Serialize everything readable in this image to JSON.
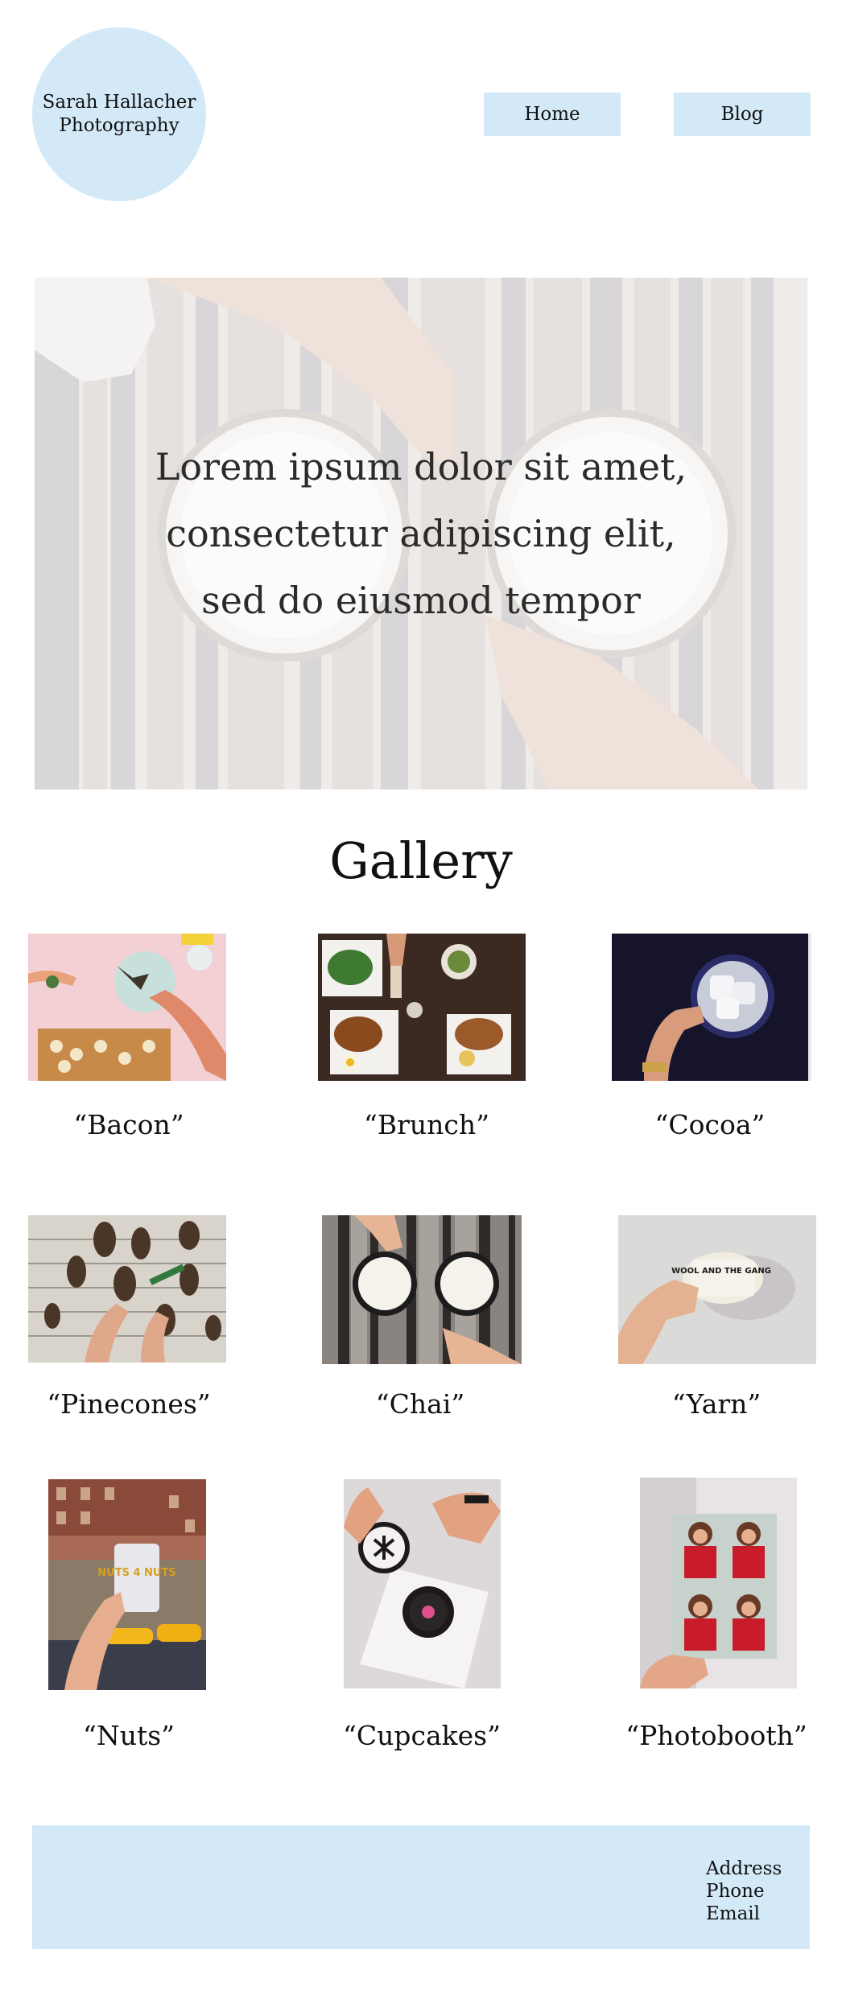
{
  "brand": {
    "line1": "Sarah Hallacher",
    "line2": "Photography"
  },
  "nav": {
    "home": "Home",
    "blog": "Blog"
  },
  "hero": {
    "line1": "Lorem ipsum dolor sit amet,",
    "line2": "consectetur adipiscing elit,",
    "line3": "sed do eiusmod tempor"
  },
  "gallery": {
    "title": "Gallery",
    "items": [
      {
        "caption": "“Bacon”"
      },
      {
        "caption": "“Brunch”"
      },
      {
        "caption": "“Cocoa”"
      },
      {
        "caption": "“Pinecones”"
      },
      {
        "caption": "“Chai”"
      },
      {
        "caption": "“Yarn”"
      },
      {
        "caption": "“Nuts”"
      },
      {
        "caption": "“Cupcakes”"
      },
      {
        "caption": "“Photobooth”"
      }
    ],
    "photo_text": {
      "yarn_label": "WOOL AND THE GANG",
      "nuts_label": "NUTS 4 NUTS"
    }
  },
  "footer": {
    "address": "Address",
    "phone": "Phone",
    "email": "Email"
  },
  "colors": {
    "accent": "#d4e9f8",
    "text": "#111111",
    "background": "#ffffff"
  }
}
